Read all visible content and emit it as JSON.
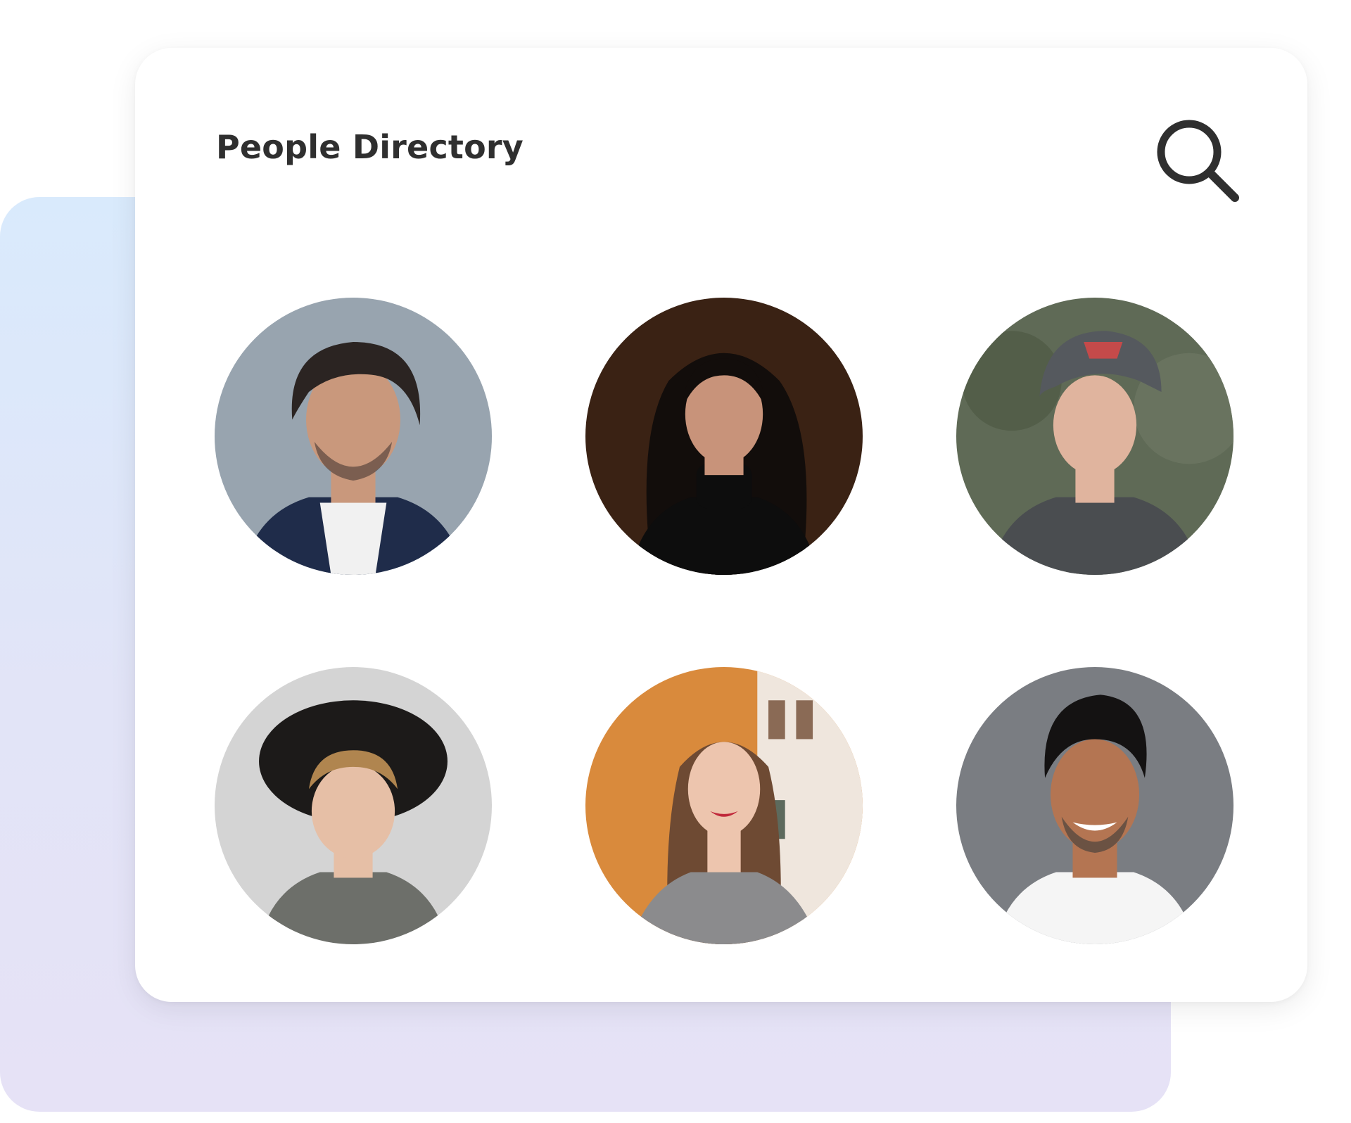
{
  "header": {
    "title": "People Directory",
    "search_icon": "search-icon"
  },
  "people": [
    {
      "avatar": "person-1",
      "bg": "#8e9aa6",
      "skin": "#c9987c",
      "hair": "#2b2422",
      "shirt": "#1f2c4a",
      "accent": "#f1f1f1"
    },
    {
      "avatar": "person-2",
      "bg": "#3a2214",
      "skin": "#c8937a",
      "hair": "#120d0b",
      "shirt": "#0d0d0d",
      "accent": "#1a1a1a"
    },
    {
      "avatar": "person-3",
      "bg": "#5f6a56",
      "skin": "#e0b49e",
      "hair": "#3a2a22",
      "shirt": "#4a4d50",
      "accent": "#55595e"
    },
    {
      "avatar": "person-4",
      "bg": "#d4d4d4",
      "skin": "#e6bfa6",
      "hair": "#1c1a19",
      "shirt": "#6d6f6a",
      "accent": "#b0854f"
    },
    {
      "avatar": "person-5",
      "bg": "#d98a3c",
      "skin": "#edc5ae",
      "hair": "#6e4a33",
      "shirt": "#8b8b8d",
      "accent": "#efe6dd"
    },
    {
      "avatar": "person-6",
      "bg": "#7a7d82",
      "skin": "#b47552",
      "hair": "#141212",
      "shirt": "#f5f5f5",
      "accent": "#3a3a3a"
    }
  ]
}
